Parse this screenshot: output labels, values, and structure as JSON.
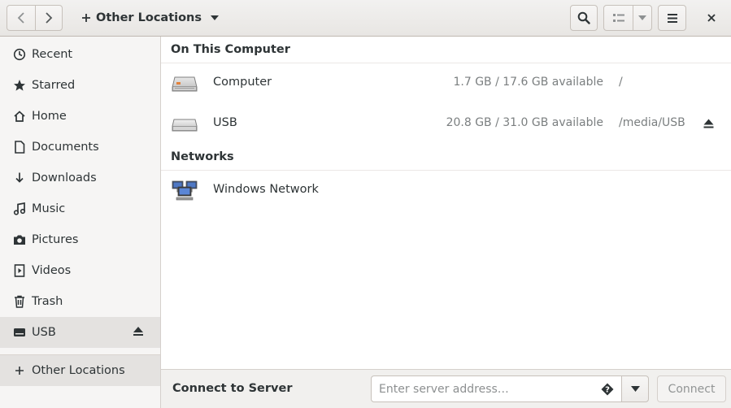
{
  "header": {
    "location_label": "Other Locations",
    "icons": {
      "back": "go-back-icon",
      "forward": "go-forward-icon",
      "add": "plus-icon",
      "location_menu": "chevron-down-icon",
      "search": "search-icon",
      "view": "list-view-icon",
      "view_menu": "chevron-down-icon",
      "menu": "hamburger-menu-icon",
      "close": "close-icon"
    }
  },
  "sidebar": {
    "items": [
      {
        "label": "Recent",
        "icon": "clock-icon"
      },
      {
        "label": "Starred",
        "icon": "star-icon"
      },
      {
        "label": "Home",
        "icon": "home-icon"
      },
      {
        "label": "Documents",
        "icon": "document-icon"
      },
      {
        "label": "Downloads",
        "icon": "download-icon"
      },
      {
        "label": "Music",
        "icon": "music-icon"
      },
      {
        "label": "Pictures",
        "icon": "camera-icon"
      },
      {
        "label": "Videos",
        "icon": "video-icon"
      },
      {
        "label": "Trash",
        "icon": "trash-icon"
      },
      {
        "label": "USB",
        "icon": "drive-icon",
        "eject": true,
        "selected": true
      }
    ],
    "other_locations": {
      "label": "Other Locations",
      "icon": "plus-icon"
    }
  },
  "main": {
    "on_this_computer": {
      "title": "On This Computer",
      "rows": [
        {
          "name": "Computer",
          "space": "1.7 GB / 17.6 GB available",
          "path": "/",
          "icon": "hard-disk-icon"
        },
        {
          "name": "USB",
          "space": "20.8 GB / 31.0 GB available",
          "path": "/media/USB",
          "icon": "removable-drive-icon",
          "eject": true
        }
      ]
    },
    "networks": {
      "title": "Networks",
      "rows": [
        {
          "name": "Windows Network",
          "icon": "network-computers-icon"
        }
      ]
    }
  },
  "bottom": {
    "connect_label": "Connect to Server",
    "server_placeholder": "Enter server address…",
    "connect_button": "Connect"
  },
  "colors": {
    "header_bg": "#e8e6e3",
    "sidebar_bg": "#f6f5f4",
    "selected_bg": "#e4e2e0",
    "secondary_text": "#7b7f80",
    "text": "#2e3436"
  }
}
